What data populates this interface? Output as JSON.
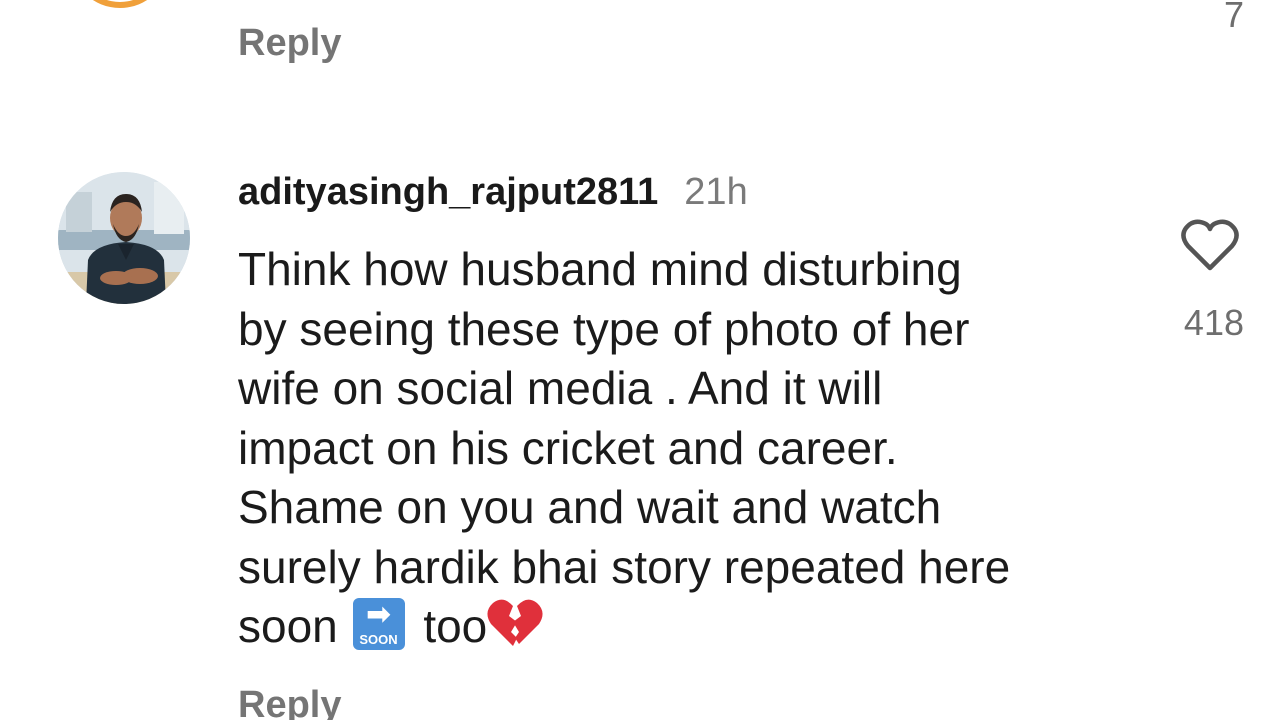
{
  "previous_comment": {
    "reply_label": "Reply",
    "like_count": "7"
  },
  "comment": {
    "username": "adityasingh_rajput2811",
    "time": "21h",
    "lines": [
      "Think how husband mind disturbing",
      "by seeing these type of photo of her",
      "wife on social media . And it will",
      "impact on his cricket and career.",
      "Shame on you and wait and watch",
      "surely hardik bhai story repeated here"
    ],
    "last_line_start": "soon",
    "soon_emoji_label": "SOON",
    "last_line_end": "too",
    "heart_emoji": "broken-heart-icon",
    "like_count": "418",
    "reply_label": "Reply"
  },
  "colors": {
    "ring": "#f0a03a",
    "muted": "#757575",
    "text": "#1b1b1b",
    "soon_blue": "#4a90d9",
    "broken_heart": "#e0303b"
  },
  "icons": {
    "like": "heart-outline-icon",
    "soon": "soon-arrow-icon"
  }
}
